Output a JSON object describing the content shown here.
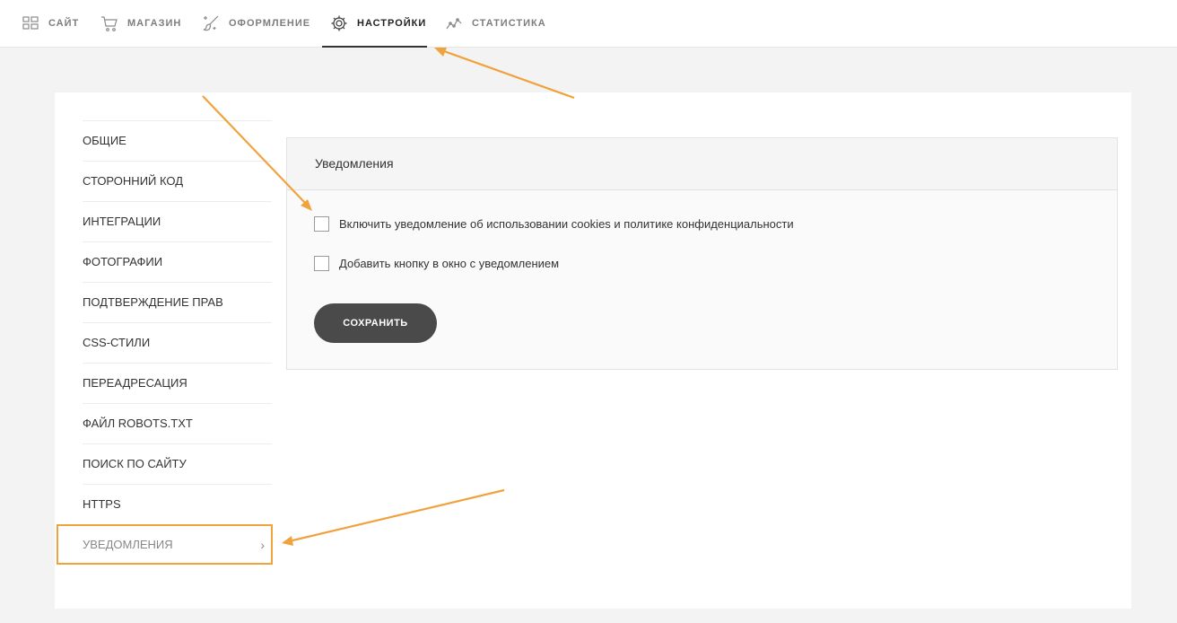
{
  "nav": {
    "tabs": [
      {
        "label": "САЙТ",
        "icon": "grid-icon"
      },
      {
        "label": "МАГАЗИН",
        "icon": "cart-icon"
      },
      {
        "label": "ОФОРМЛЕНИЕ",
        "icon": "brush-icon"
      },
      {
        "label": "НАСТРОЙКИ",
        "icon": "gear-icon",
        "active": true
      },
      {
        "label": "СТАТИСТИКА",
        "icon": "chart-line-icon"
      }
    ]
  },
  "sidebar": {
    "items": [
      {
        "label": "ОБЩИЕ"
      },
      {
        "label": "СТОРОННИЙ КОД"
      },
      {
        "label": "ИНТЕГРАЦИИ"
      },
      {
        "label": "ФОТОГРАФИИ"
      },
      {
        "label": "ПОДТВЕРЖДЕНИЕ ПРАВ"
      },
      {
        "label": "CSS-СТИЛИ"
      },
      {
        "label": "ПЕРЕАДРЕСАЦИЯ"
      },
      {
        "label": "ФАЙЛ ROBOTS.TXT"
      },
      {
        "label": "ПОИСК ПО САЙТУ"
      },
      {
        "label": "HTTPS"
      },
      {
        "label": "УВЕДОМЛЕНИЯ",
        "active": true
      }
    ]
  },
  "card": {
    "title": "Уведомления",
    "options": [
      {
        "label": "Включить уведомление об использовании cookies и политике конфиденциальности",
        "checked": false
      },
      {
        "label": "Добавить кнопку в окно с уведомлением",
        "checked": false
      }
    ],
    "save_label": "СОХРАНИТЬ"
  },
  "colors": {
    "accent_arrow": "#f0a23c",
    "button_bg": "#4a4a4a",
    "page_bg": "#f3f3f3"
  }
}
